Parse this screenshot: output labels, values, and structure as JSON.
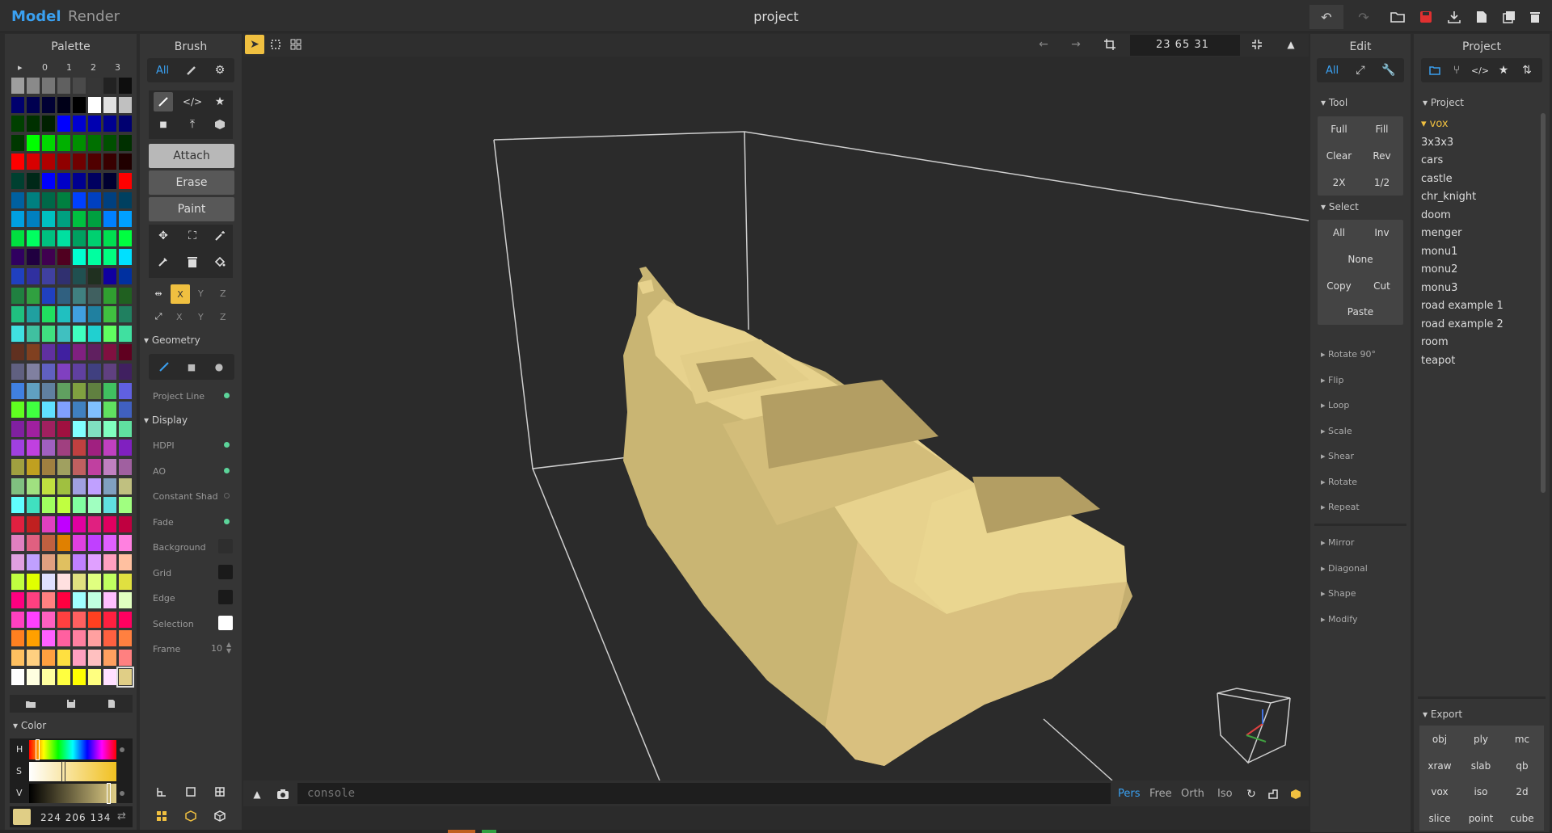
{
  "top": {
    "mode_model": "Model",
    "mode_render": "Render",
    "title": "project"
  },
  "palette": {
    "header": "Palette",
    "tabs": [
      "▸",
      "0",
      "1",
      "2",
      "3"
    ],
    "colors": [
      "#9e9e9e",
      "#8a8a8a",
      "#767676",
      "#606060",
      "#4a4a4a",
      "#363636",
      "#222222",
      "#0e0e0e",
      "#00006e",
      "#000050",
      "#000034",
      "#000018",
      "#000000",
      "#ffffff",
      "#e0e0e0",
      "#c0c0c0",
      "#004000",
      "#003000",
      "#002000",
      "#0000ff",
      "#0000d0",
      "#0000b0",
      "#000090",
      "#000070",
      "#003800",
      "#00ff00",
      "#00d800",
      "#00b000",
      "#009000",
      "#007000",
      "#005000",
      "#003000",
      "#ff0000",
      "#d80000",
      "#b00000",
      "#900000",
      "#700000",
      "#500000",
      "#380000",
      "#200000",
      "#004030",
      "#002818",
      "#0000ff",
      "#0000c8",
      "#000090",
      "#000060",
      "#000030",
      "#ff0000",
      "#0060a0",
      "#008080",
      "#006848",
      "#008040",
      "#0040ff",
      "#0040c0",
      "#004080",
      "#004060",
      "#00a0e0",
      "#0080c0",
      "#00c0c0",
      "#00a080",
      "#00c040",
      "#00a040",
      "#0080ff",
      "#00a0ff",
      "#00e040",
      "#00ff60",
      "#00c080",
      "#00e0a0",
      "#00a060",
      "#00d070",
      "#00e050",
      "#00ff40",
      "#300060",
      "#200040",
      "#400050",
      "#500020",
      "#00ffd0",
      "#00ffa0",
      "#00ff80",
      "#00e0ff",
      "#2040c0",
      "#3030a0",
      "#4040a0",
      "#303070",
      "#205050",
      "#203020",
      "#1000a0",
      "#0030a0",
      "#208040",
      "#30a040",
      "#2040c0",
      "#306080",
      "#408080",
      "#406060",
      "#30a030",
      "#206020",
      "#20c080",
      "#20a0a0",
      "#20e060",
      "#20c0c0",
      "#40a0e0",
      "#2080a0",
      "#40c040",
      "#208060",
      "#40e0e0",
      "#40c0a0",
      "#40e080",
      "#40c0c0",
      "#40ffc0",
      "#20d0d0",
      "#60ff60",
      "#40e0a0",
      "#603020",
      "#804020",
      "#6030a0",
      "#4020a0",
      "#802080",
      "#602060",
      "#801040",
      "#600020",
      "#606080",
      "#8080a0",
      "#6060c0",
      "#8040c0",
      "#6040a0",
      "#404080",
      "#604080",
      "#402060",
      "#4080e0",
      "#60a0c0",
      "#6080a0",
      "#60a060",
      "#80a040",
      "#608040",
      "#40c060",
      "#6060e0",
      "#60ff20",
      "#40ff40",
      "#60e0ff",
      "#80a0ff",
      "#4080c0",
      "#80c0ff",
      "#60e060",
      "#4060c0",
      "#8020a0",
      "#a020a0",
      "#a02060",
      "#a01040",
      "#80ffff",
      "#80e0c0",
      "#80ffc0",
      "#60e0a0",
      "#a040e0",
      "#c040e0",
      "#a060c0",
      "#a04080",
      "#c04040",
      "#a02080",
      "#c040c0",
      "#8020c0",
      "#a0a040",
      "#c0a020",
      "#a08040",
      "#a0a060",
      "#c06060",
      "#c040a0",
      "#c080c0",
      "#a060a0",
      "#80c080",
      "#a0e080",
      "#c0e040",
      "#a0c040",
      "#a0a0e0",
      "#c0a0ff",
      "#80a0c0",
      "#c0c080",
      "#60ffff",
      "#40e0c0",
      "#a0ff60",
      "#c0ff40",
      "#80ffa0",
      "#a0ffc0",
      "#60e0e0",
      "#a0ff80",
      "#e02040",
      "#c02020",
      "#e040c0",
      "#c000ff",
      "#e000a0",
      "#e02080",
      "#e00060",
      "#c00040",
      "#e080c0",
      "#e06080",
      "#c06040",
      "#e08000",
      "#e040e0",
      "#c040ff",
      "#e060ff",
      "#ff80e0",
      "#e0a0e0",
      "#c0a0ff",
      "#e0a080",
      "#e0c060",
      "#c080ff",
      "#e0a0ff",
      "#ffa0c0",
      "#ffc0a0",
      "#c0ff40",
      "#e0ff00",
      "#e0e0ff",
      "#ffe0e0",
      "#e0e080",
      "#e0ff80",
      "#c0ff60",
      "#e0e040",
      "#ff0080",
      "#ff4080",
      "#ff8080",
      "#ff0040",
      "#a0ffff",
      "#c0ffe0",
      "#ffc0ff",
      "#e0ffc0",
      "#ff40c0",
      "#ff40ff",
      "#ff60c0",
      "#ff4040",
      "#ff6060",
      "#ff4020",
      "#ff2040",
      "#ff0060",
      "#ff8020",
      "#ffa000",
      "#ff60ff",
      "#ff60a0",
      "#ff80a0",
      "#ffa0a0",
      "#ff6040",
      "#ff8040",
      "#ffc060",
      "#ffd080",
      "#ffa040",
      "#ffe040",
      "#ffa0c0",
      "#ffc0c0",
      "#ffa060",
      "#ff8080",
      "#ffffff",
      "#ffffe0",
      "#ffffa0",
      "#ffff40",
      "#ffff00",
      "#ffff80",
      "#ffe0ff",
      "#e0ce86"
    ],
    "color_header": "Color",
    "h": "H",
    "s": "S",
    "v": "V",
    "rgb": "224 206 134",
    "selected_color": "#e0ce86"
  },
  "brush": {
    "header": "Brush",
    "all": "All",
    "attach": "Attach",
    "erase": "Erase",
    "paint": "Paint",
    "x": "X",
    "y": "Y",
    "z": "Z",
    "geometry": "Geometry",
    "project_line": "Project Line",
    "display": "Display",
    "hdpi": "HDPI",
    "ao": "AO",
    "constant_shad": "Constant Shad",
    "fade": "Fade",
    "background": "Background",
    "grid": "Grid",
    "edge": "Edge",
    "selection": "Selection",
    "frame": "Frame",
    "frame_value": "10"
  },
  "viewport": {
    "coords": "23 65 31",
    "console_placeholder": "console",
    "views": [
      "Pers",
      "Free",
      "Orth",
      "Iso"
    ]
  },
  "edit": {
    "header": "Edit",
    "all": "All",
    "tool": "Tool",
    "full": "Full",
    "fill": "Fill",
    "clear": "Clear",
    "rev": "Rev",
    "x2": "2X",
    "half": "1/2",
    "select": "Select",
    "sel_all": "All",
    "inv": "Inv",
    "none": "None",
    "copy": "Copy",
    "cut": "Cut",
    "paste": "Paste",
    "groups1": [
      "Rotate 90°",
      "Flip",
      "Loop",
      "Scale",
      "Shear",
      "Rotate",
      "Repeat"
    ],
    "groups2": [
      "Mirror",
      "Diagonal",
      "Shape",
      "Modify"
    ]
  },
  "project": {
    "header": "Project",
    "section": "Project",
    "items": [
      "vox",
      "3x3x3",
      "cars",
      "castle",
      "chr_knight",
      "doom",
      "menger",
      "monu1",
      "monu2",
      "monu3",
      "road example 1",
      "road example 2",
      "room",
      "teapot"
    ],
    "export": "Export",
    "export_items": [
      "obj",
      "ply",
      "mc",
      "xraw",
      "slab",
      "qb",
      "vox",
      "iso",
      "2d",
      "slice",
      "point",
      "cube"
    ]
  },
  "colors": {
    "accent": "#3aa0f0",
    "highlight": "#f0c040",
    "voxel": "#e0ce86"
  }
}
